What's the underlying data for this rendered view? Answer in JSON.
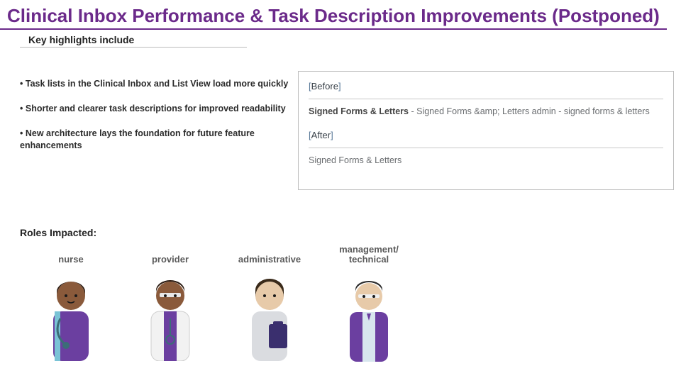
{
  "title": "Clinical Inbox Performance & Task Description Improvements (Postponed)",
  "highlights_heading": "Key highlights include",
  "bullets": [
    "Task lists in the Clinical Inbox and List View load more quickly",
    "Shorter and clearer task descriptions for improved readability",
    "New architecture lays the foundation for future feature enhancements"
  ],
  "compare": {
    "before_label": "Before",
    "before_text_bold": "Signed Forms & Letters",
    "before_text_rest": " - Signed Forms &amp; Letters admin - signed forms & letters",
    "after_label": "After",
    "after_text": "Signed Forms & Letters"
  },
  "roles_heading": "Roles Impacted:",
  "roles": [
    {
      "label": "nurse"
    },
    {
      "label": "provider"
    },
    {
      "label": "administrative"
    },
    {
      "label": "management/ technical"
    }
  ]
}
